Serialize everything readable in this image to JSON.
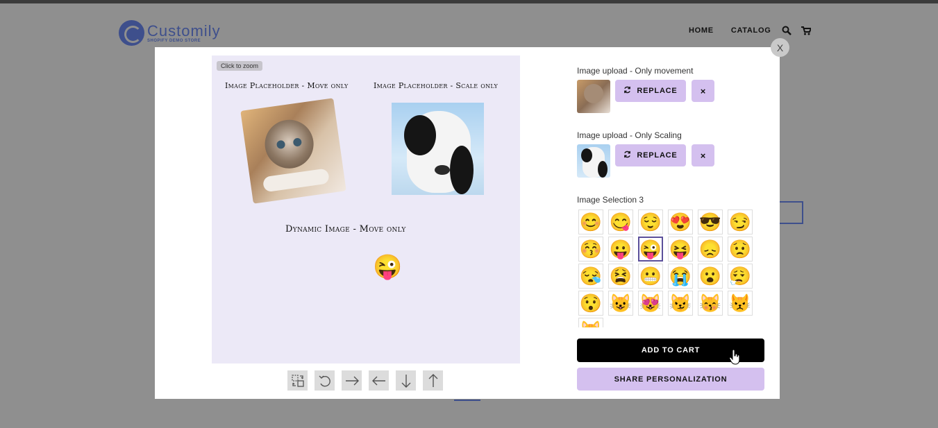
{
  "store": {
    "logo_name": "Customily",
    "logo_subtitle": "SHOPIFY DEMO STORE",
    "nav": [
      "HOME",
      "CATALOG"
    ],
    "icons": [
      "search-icon",
      "cart-icon"
    ]
  },
  "modal": {
    "close_label": "X",
    "zoom_badge": "Click to zoom",
    "canvas": {
      "title_move": "Image Placeholder - Move only",
      "title_scale": "Image Placeholder - Scale only",
      "title_dynamic": "Dynamic Image - Move only",
      "dynamic_emoji": "😜"
    },
    "toolbar": [
      "swap-icon",
      "rotate-ccw-icon",
      "arrow-right-icon",
      "arrow-left-icon",
      "arrow-down-icon",
      "arrow-up-icon"
    ]
  },
  "options": {
    "upload_move": {
      "label": "Image upload - Only movement",
      "replace_label": "REPLACE",
      "remove_label": "×"
    },
    "upload_scale": {
      "label": "Image upload - Only Scaling",
      "replace_label": "REPLACE",
      "remove_label": "×"
    },
    "selection": {
      "label": "Image Selection 3",
      "selected_index": 8,
      "emojis": [
        "😊",
        "😋",
        "😌",
        "😍",
        "😎",
        "😏",
        "😚",
        "😛",
        "😜",
        "😝",
        "😞",
        "😟",
        "😪",
        "😫",
        "😬",
        "😭",
        "😮",
        "😮‍💨",
        "😯",
        "😺",
        "😻",
        "😼",
        "😽",
        "😾",
        "😸"
      ]
    },
    "add_to_cart_label": "ADD TO CART",
    "share_label": "SHARE PERSONALIZATION"
  },
  "colors": {
    "accent": "#d4c0ef",
    "brand": "#3e4f8c",
    "canvas_bg": "#ece9f7",
    "overlay": "#8f8f8f"
  }
}
